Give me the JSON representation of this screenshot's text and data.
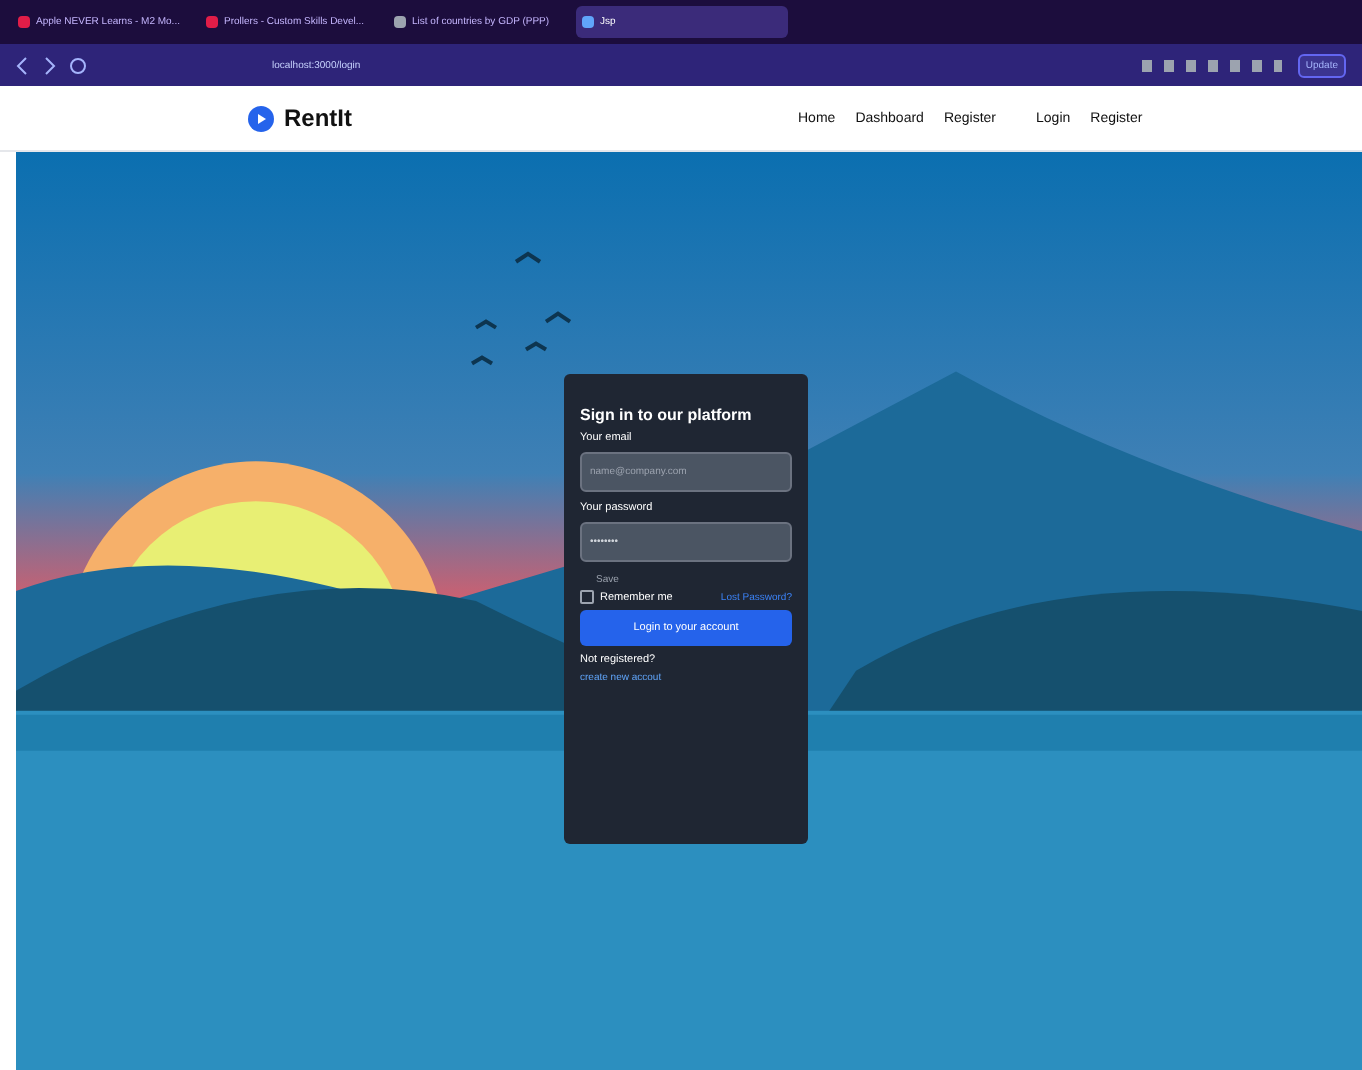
{
  "browser": {
    "tabs": [
      {
        "title": "Apple NEVER Learns - M2 Mo...",
        "selected": false,
        "color": "#e11d48"
      },
      {
        "title": "Prollers - Custom Skills Devel...",
        "selected": false,
        "color": "#e11d48"
      },
      {
        "title": "List of countries by GDP (PPP)",
        "selected": false,
        "color": "#9ca3af"
      },
      {
        "title": "Jsp",
        "selected": true,
        "color": "#60a5fa"
      }
    ],
    "address": "localhost:3000/login",
    "update_label": "Update"
  },
  "navbar": {
    "brand": "RentIt",
    "links": [
      "Home",
      "Dashboard",
      "Register",
      "Login",
      "Register"
    ]
  },
  "login": {
    "title": "Sign in to our platform",
    "email_label": "Your email",
    "email_placeholder": "name@company.com",
    "password_label": "Your password",
    "password_value": "••••••••",
    "hint": "Save",
    "remember_label": "Remember me",
    "remember_checked": false,
    "lost_password": "Lost Password?",
    "submit": "Login to your account",
    "not_registered": "Not registered?",
    "create_account": "create new accout"
  }
}
